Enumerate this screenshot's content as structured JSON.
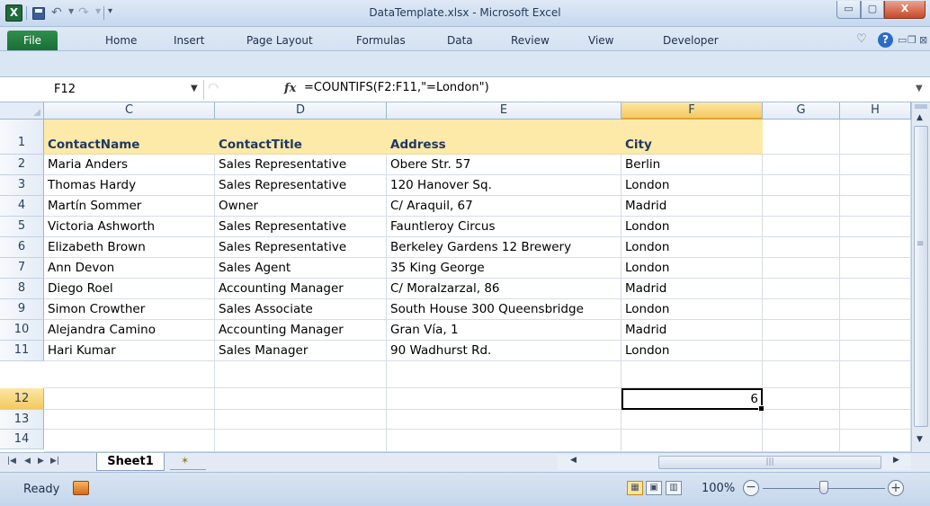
{
  "window": {
    "title": "DataTemplate.xlsx - Microsoft Excel"
  },
  "icons": {
    "app": "X",
    "minimize": "▭",
    "maximize": "▢",
    "close": "X",
    "help": "?",
    "undo": "↶",
    "redo": "↷",
    "fx": "fx"
  },
  "ribbon": {
    "file": "File",
    "tabs": [
      "Home",
      "Insert",
      "Page Layout",
      "Formulas",
      "Data",
      "Review",
      "View",
      "Developer"
    ]
  },
  "formula_bar": {
    "name_box": "F12",
    "formula": "=COUNTIFS(F2:F11,\"=London\")"
  },
  "columns": [
    "C",
    "D",
    "E",
    "F",
    "G",
    "H"
  ],
  "selected_column": "F",
  "rows": [
    "1",
    "2",
    "3",
    "4",
    "5",
    "6",
    "7",
    "8",
    "9",
    "10",
    "11",
    "12",
    "13",
    "14"
  ],
  "selected_row": "12",
  "table": {
    "headers": [
      "ContactName",
      "ContactTitle",
      "Address",
      "City"
    ],
    "rows": [
      [
        "Maria Anders",
        "Sales Representative",
        "Obere Str. 57",
        "Berlin"
      ],
      [
        "Thomas Hardy",
        "Sales Representative",
        "120 Hanover Sq.",
        "London"
      ],
      [
        "Martín Sommer",
        "Owner",
        "C/ Araquil, 67",
        "Madrid"
      ],
      [
        "Victoria Ashworth",
        "Sales Representative",
        "Fauntleroy Circus",
        "London"
      ],
      [
        "Elizabeth Brown",
        "Sales Representative",
        "Berkeley Gardens 12  Brewery",
        "London"
      ],
      [
        "Ann Devon",
        "Sales Agent",
        "35 King George",
        "London"
      ],
      [
        "Diego Roel",
        "Accounting Manager",
        "C/ Moralzarzal, 86",
        "Madrid"
      ],
      [
        "Simon Crowther",
        "Sales Associate",
        "South House 300 Queensbridge",
        "London"
      ],
      [
        "Alejandra Camino",
        "Accounting Manager",
        "Gran Vía, 1",
        "Madrid"
      ],
      [
        "Hari Kumar",
        "Sales Manager",
        "90 Wadhurst Rd.",
        "London"
      ]
    ],
    "result_value": "6"
  },
  "sheet_tabs": [
    "Sheet1"
  ],
  "status": {
    "ready": "Ready",
    "zoom": "100%"
  },
  "colors": {
    "header_fill": "#fde9a8",
    "header_text": "#1f3864",
    "selection_highlight": "#f4c95f",
    "file_tab": "#1a6e35"
  }
}
